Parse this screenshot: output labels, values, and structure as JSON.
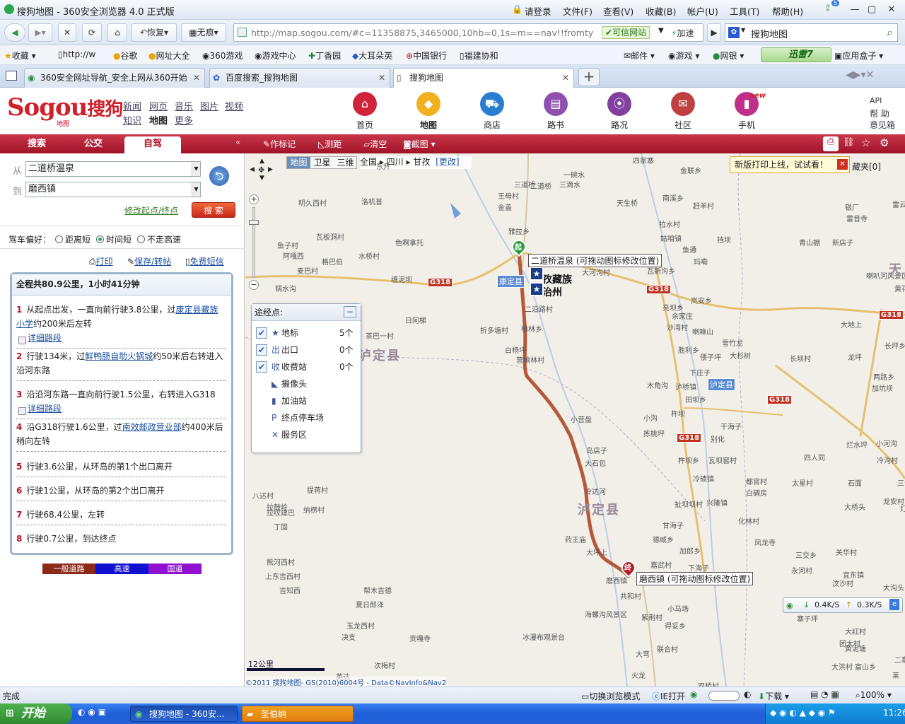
{
  "browser": {
    "title": "搜狗地图 - 360安全浏览器 4.0 正式版",
    "login": "请登录",
    "menus": [
      "文件(F)",
      "查看(V)",
      "收藏(B)",
      "帐户(U)",
      "工具(T)",
      "帮助(H)"
    ],
    "restore_label": "恢复",
    "noimage_label": "无痕",
    "address": "http://map.sogou.com/#c=11358875,3465000,10hb=0,1s=m==nav!!fromty",
    "trusted_label": "可信网站",
    "speedup_label": "加速",
    "search_engine": "搜狗地图",
    "bookmarks": [
      "收藏",
      "http://w",
      "谷歌",
      "网址大全",
      "360游戏",
      "游戏中心",
      "丁香园",
      "大耳朵英",
      "中国银行",
      "福建协和"
    ],
    "bookmarks_right": [
      "邮件",
      "游戏",
      "网银",
      "迅雷7",
      "应用盒子"
    ],
    "tabs": [
      {
        "label": "360安全网址导航_安全上网从360开始"
      },
      {
        "label": "百度搜索_搜狗地图"
      },
      {
        "label": "搜狗地图"
      }
    ],
    "tab_count_badge": "5",
    "status_text": "完成",
    "status_mode": "切换浏览模式",
    "status_ie": "IE打开",
    "status_download": "下载",
    "status_zoom": "100%",
    "net_down": "0.4K/S",
    "net_up": "0.3K/S"
  },
  "site": {
    "logo_text": "Sogou",
    "logo_cn": "搜狗",
    "logo_sub": "地图",
    "links_row1": [
      "新闻",
      "网页",
      "音乐",
      "图片",
      "视频"
    ],
    "links_row2": [
      "知识",
      "地图",
      "更多"
    ],
    "nav": [
      {
        "label": "首页",
        "color": "#d0243a",
        "icon": "home-icon"
      },
      {
        "label": "地图",
        "color": "#f0b020",
        "icon": "china-map-icon"
      },
      {
        "label": "商店",
        "color": "#2a7ed2",
        "icon": "cart-icon"
      },
      {
        "label": "路书",
        "color": "#9050b0",
        "icon": "book-icon"
      },
      {
        "label": "路况",
        "color": "#8040a0",
        "icon": "traffic-light-icon"
      },
      {
        "label": "社区",
        "color": "#c04040",
        "icon": "chat-icon"
      },
      {
        "label": "手机",
        "color": "#c0308a",
        "icon": "phone-icon"
      }
    ],
    "new_badge": "new",
    "right_links": [
      "API",
      "帮 助",
      "意见箱"
    ]
  },
  "toolbar": {
    "tabs": [
      "搜索",
      "公交",
      "自驾"
    ],
    "tools": [
      "作标记",
      "测距",
      "清空",
      "截图"
    ],
    "collapse": "«"
  },
  "route_form": {
    "from_label": "从",
    "from_value": "二道桥温泉",
    "to_label": "到",
    "to_value": "磨西镇",
    "modify_link": "修改起点/终点",
    "search_button": "搜 索",
    "pref_label": "驾车偏好：",
    "prefs": [
      "距离短",
      "时间短",
      "不走高速"
    ],
    "pref_selected": "时间短",
    "actions": [
      "打印",
      "保存/转帖",
      "免费短信"
    ]
  },
  "route": {
    "summary": "全程共80.9公里，1小时41分钟",
    "steps": [
      {
        "n": "1",
        "text_a": "从起点出发，一直向前行驶3.8公里，过",
        "link": "康定县藏族小学",
        "text_b": "约200米后左转",
        "detail": "详细路段"
      },
      {
        "n": "2",
        "text_a": "行驶134米，过",
        "link": "鲜鸭肠自助火锅城",
        "text_b": "约50米后右转进入沿河东路",
        "detail": ""
      },
      {
        "n": "3",
        "text_a": "沿沿河东路一直向前行驶1.5公里，右转进入G318",
        "link": "",
        "text_b": "",
        "detail": "详细路段"
      },
      {
        "n": "4",
        "text_a": "沿G318行驶1.6公里，过",
        "link": "南效邮政营业部",
        "text_b": "约400米后稍向左转",
        "detail": ""
      },
      {
        "n": "5",
        "text_a": "行驶3.6公里，从环岛的第1个出口离开",
        "link": "",
        "text_b": "",
        "detail": ""
      },
      {
        "n": "6",
        "text_a": "行驶1公里，从环岛的第2个出口离开",
        "link": "",
        "text_b": "",
        "detail": ""
      },
      {
        "n": "7",
        "text_a": "行驶68.4公里，左转",
        "link": "",
        "text_b": "",
        "detail": ""
      },
      {
        "n": "8",
        "text_a": "行驶0.7公里，到达终点",
        "link": "",
        "text_b": "",
        "detail": ""
      }
    ],
    "legend": [
      {
        "label": "一般道路",
        "color": "#8b2a1a"
      },
      {
        "label": "高速",
        "color": "#1010d0"
      },
      {
        "label": "国道",
        "color": "#9010d0"
      }
    ]
  },
  "map": {
    "type_buttons": [
      "地图",
      "卫星",
      "三维"
    ],
    "type_selected": "地图",
    "breadcrumb": [
      "全国",
      "四川",
      "甘孜"
    ],
    "change_link": "[更改]",
    "print_notice": "新版打印上线，试试看！",
    "fav_label": "藏夹[0]",
    "waypoints_title": "途经点:",
    "waypoints": [
      {
        "label": "地标",
        "count": "5个",
        "checked": true,
        "icon": "star-icon"
      },
      {
        "label": "出口",
        "count": "0个",
        "checked": true,
        "icon": "exit-icon"
      },
      {
        "label": "收费站",
        "count": "0个",
        "checked": true,
        "icon": "toll-icon"
      },
      {
        "label": "摄像头",
        "count": "",
        "checked": false,
        "icon": "camera-icon"
      },
      {
        "label": "加油站",
        "count": "",
        "checked": false,
        "icon": "gas-icon"
      },
      {
        "label": "终点停车场",
        "count": "",
        "checked": false,
        "icon": "parking-icon"
      },
      {
        "label": "服务区",
        "count": "",
        "checked": false,
        "icon": "service-icon"
      }
    ],
    "start_label": "二道桥温泉 (可拖动图标修改位置)",
    "end_label": "磨西镇 (可拖动图标修改位置)",
    "start_badge": "起",
    "end_badge": "终",
    "county_badge_1": "康定县",
    "county_badge_2": "泸定县",
    "highway": "G318",
    "big_labels": [
      "泸定县",
      "泸定县",
      "天"
    ],
    "zhou_label_1": "孜藏族",
    "zhou_label_2": "治州",
    "scale": "12公里",
    "copyright": "©2011 搜狗地图- GS(2010)6004号 - Data©NavInfo&Nav2",
    "places": [
      [
        "东升",
        185,
        10
      ],
      [
        "一碗水",
        450,
        22
      ],
      [
        "四家寨",
        548,
        2
      ],
      [
        "金联乡",
        615,
        16
      ],
      [
        "三道桥",
        380,
        36
      ],
      [
        "二道桥",
        403,
        38
      ],
      [
        "三滴水",
        444,
        36
      ],
      [
        "王母村",
        357,
        52
      ],
      [
        "洛机普",
        164,
        60
      ],
      [
        "金盖",
        357,
        68
      ],
      [
        "明久西村",
        75,
        62
      ],
      [
        "天生桥",
        525,
        62
      ],
      [
        "南溪乡",
        590,
        55
      ],
      [
        "赶羊村",
        633,
        66
      ],
      [
        "银厂",
        848,
        68
      ],
      [
        "雷音寺",
        850,
        84
      ],
      [
        "雷云寺",
        915,
        64
      ],
      [
        "拉水村",
        585,
        92
      ],
      [
        "雅拉乡",
        372,
        102
      ],
      [
        "瓦板洞村",
        100,
        110
      ],
      [
        "色啊拿托",
        212,
        118
      ],
      [
        "鱼子村",
        45,
        122
      ],
      [
        "阿嘎西",
        53,
        137
      ],
      [
        "水桥村",
        160,
        137
      ],
      [
        "大河沟村",
        476,
        160
      ],
      [
        "姑咱镇",
        587,
        112
      ],
      [
        "青山棚",
        783,
        118
      ],
      [
        "新店子",
        830,
        118
      ],
      [
        "挡坝",
        667,
        114
      ],
      [
        "麦巴村",
        73,
        158
      ],
      [
        "格巴伯",
        108,
        145
      ],
      [
        "缠泥坝",
        206,
        170
      ],
      [
        "瓦斯沟乡",
        568,
        158
      ],
      [
        "喇叭河风景区",
        878,
        165
      ],
      [
        "玛嘞",
        634,
        145
      ],
      [
        "鱼通",
        618,
        128
      ],
      [
        "锅水沟",
        42,
        183
      ],
      [
        "二沿路村",
        395,
        212
      ],
      [
        "亮坝乡",
        590,
        210
      ],
      [
        "余家庄",
        603,
        222
      ],
      [
        "岚安乡",
        630,
        200
      ],
      [
        "沙湾村",
        596,
        238
      ],
      [
        "喇嘛山",
        632,
        244
      ],
      [
        "大渡口",
        935,
        185
      ],
      [
        "黄花村",
        918,
        183
      ],
      [
        "日阿梯",
        226,
        228
      ],
      [
        "茶巴一村",
        170,
        250
      ],
      [
        "折多塘村",
        332,
        242
      ],
      [
        "榆林乡",
        390,
        240
      ],
      [
        "大地上",
        842,
        234
      ],
      [
        "长坪乡",
        904,
        264
      ],
      [
        "龙坪",
        852,
        280
      ],
      [
        "胜利乡",
        612,
        270
      ],
      [
        "雪竹龙",
        674,
        260
      ],
      [
        "偎子坪",
        643,
        280
      ],
      [
        "大杉树",
        685,
        278
      ],
      [
        "长坝村",
        770,
        282
      ],
      [
        "白杨坪",
        367,
        270
      ],
      [
        "营榆林村",
        383,
        284
      ],
      [
        "下庄子",
        628,
        302
      ],
      [
        "两路乡",
        888,
        308
      ],
      [
        "加坑坝",
        886,
        324
      ],
      [
        "木角沟",
        568,
        320
      ],
      [
        "泸桥镇",
        608,
        322
      ],
      [
        "田坝乡",
        622,
        340
      ],
      [
        "干海子",
        672,
        378
      ],
      [
        "小营盘",
        460,
        368
      ],
      [
        "小沟",
        563,
        366
      ],
      [
        "拣桃坪",
        563,
        388
      ],
      [
        "杵坝",
        602,
        360
      ],
      [
        "别化",
        658,
        396
      ],
      [
        "四人同",
        790,
        422
      ],
      [
        "烂水坪",
        850,
        404
      ],
      [
        "小河沟",
        892,
        402
      ],
      [
        "冷沟村",
        893,
        426
      ],
      [
        "杵坝乡",
        612,
        426
      ],
      [
        "冷碛镇",
        633,
        452
      ],
      [
        "岛店子",
        482,
        412
      ],
      [
        "大石包",
        480,
        430
      ],
      [
        "瓦坝窖村",
        655,
        426
      ],
      [
        "都官村",
        708,
        456
      ],
      [
        "白碉房",
        708,
        472
      ],
      [
        "太星村",
        773,
        458
      ],
      [
        "三合乡",
        922,
        458
      ],
      [
        "石面",
        852,
        458
      ],
      [
        "扯坝坝村",
        607,
        488
      ],
      [
        "兴隆镇",
        652,
        486
      ],
      [
        "龙安村",
        902,
        484
      ],
      [
        "大桥头",
        847,
        492
      ],
      [
        "灯火",
        926,
        494
      ],
      [
        "提蒋村",
        87,
        468
      ],
      [
        "拉鼓岭",
        30,
        492
      ],
      [
        "拉纹建巴",
        30,
        500
      ],
      [
        "纳楞村",
        82,
        496
      ],
      [
        "八达村",
        10,
        476
      ],
      [
        "丁固",
        40,
        520
      ],
      [
        "冷达河",
        480,
        470
      ],
      [
        "化林村",
        697,
        512
      ],
      [
        "甘海子",
        590,
        518
      ],
      [
        "德威乡",
        576,
        538
      ],
      [
        "凤龙寺",
        720,
        542
      ],
      [
        "三交乡",
        778,
        560
      ],
      [
        "关华村",
        835,
        556
      ],
      [
        "大坪上",
        482,
        556
      ],
      [
        "药王庙",
        452,
        538
      ],
      [
        "加郎乡",
        614,
        554
      ],
      [
        "嘉武村",
        573,
        574
      ],
      [
        "下海子",
        626,
        578
      ],
      [
        "永河村",
        772,
        582
      ],
      [
        "宜东镇",
        845,
        588
      ],
      [
        "熊河西村",
        30,
        570
      ],
      [
        "上东吉西村",
        28,
        590
      ],
      [
        "吉知西",
        48,
        610
      ],
      [
        "帮木吉德",
        167,
        610
      ],
      [
        "夏日郎泽",
        156,
        630
      ],
      [
        "共和村",
        530,
        618
      ],
      [
        "磨西镇",
        510,
        596
      ],
      [
        "小马场",
        597,
        636
      ],
      [
        "得妥乡",
        593,
        660
      ],
      [
        "汶沙村",
        830,
        600
      ],
      [
        "大沟头",
        902,
        606
      ],
      [
        "海螺沟风景区",
        480,
        644
      ],
      [
        "紫荆村",
        560,
        648
      ],
      [
        "玉龙西村",
        143,
        660
      ],
      [
        "决支",
        136,
        676
      ],
      [
        "贡嘎寺",
        232,
        678
      ],
      [
        "冰瀑布观景台",
        392,
        676
      ],
      [
        "大红村",
        848,
        668
      ],
      [
        "团大村",
        840,
        685
      ],
      [
        "黄泥塘",
        848,
        692
      ],
      [
        "大洪村",
        829,
        718
      ],
      [
        "富山乡",
        862,
        718
      ],
      [
        "大弯",
        552,
        700
      ],
      [
        "联合村",
        582,
        693
      ],
      [
        "次梅村",
        182,
        716
      ],
      [
        "英达",
        128,
        732
      ],
      [
        "二寨",
        918,
        708
      ],
      [
        "莱",
        915,
        730
      ],
      [
        "火龙",
        546,
        730
      ],
      [
        "双桥村",
        640,
        745
      ],
      [
        "寨子坪",
        780,
        650
      ]
    ]
  }
}
